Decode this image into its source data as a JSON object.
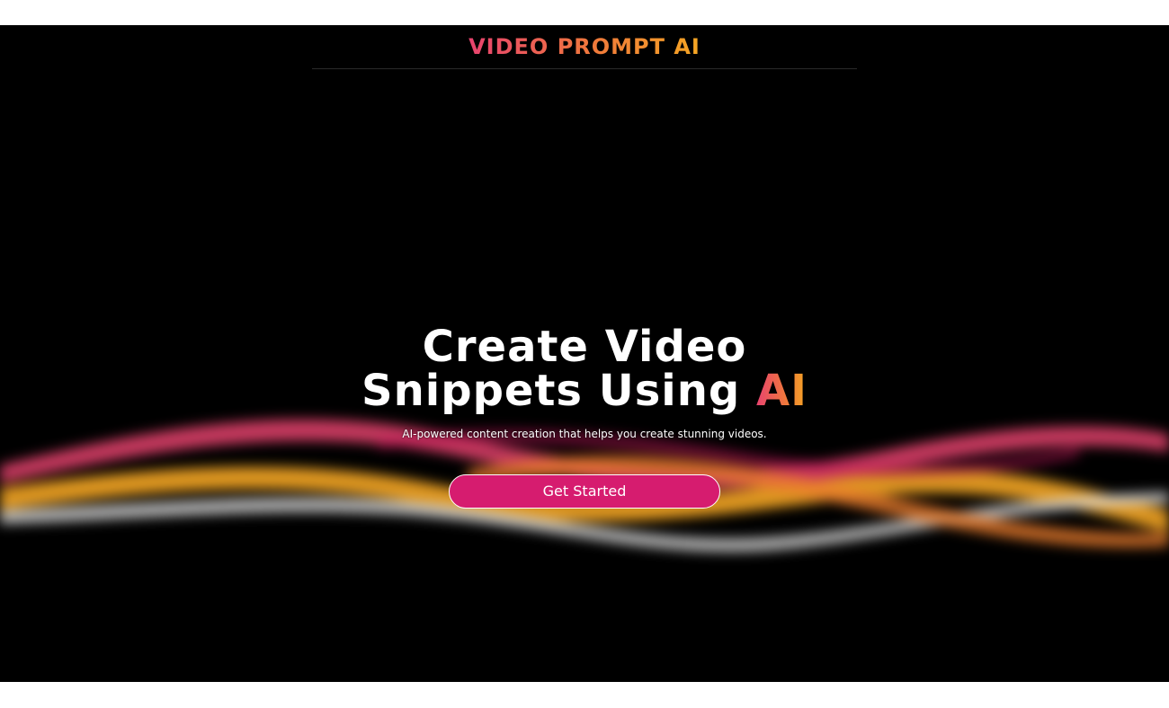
{
  "header": {
    "brand": "VIDEO PROMPT AI"
  },
  "hero": {
    "headline_line1": "Create Video",
    "headline_line2_prefix": "Snippets Using ",
    "headline_line2_accent": "AI",
    "subtitle": "AI-powered content creation that helps you create stunning videos.",
    "cta_label": "Get Started"
  },
  "colors": {
    "background": "#000000",
    "page_background": "#ffffff",
    "cta_background": "#d61c6f",
    "gradient_start": "#e8436f",
    "gradient_end": "#f5a623",
    "wave_colors": [
      "#e8436f",
      "#f5a623",
      "#ffffff",
      "#ec7d2d"
    ]
  }
}
